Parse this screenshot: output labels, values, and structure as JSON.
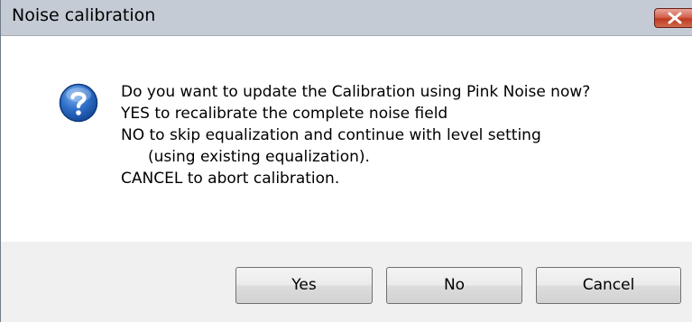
{
  "window": {
    "title": "Noise calibration"
  },
  "icons": {
    "close": "close-icon",
    "question": "question-icon"
  },
  "message": {
    "lines": [
      "Do you want to update the Calibration using Pink Noise now?",
      "YES to recalibrate the complete noise field",
      "NO to skip equalization and continue with level setting",
      "(using existing equalization).",
      "CANCEL to abort calibration."
    ]
  },
  "buttons": {
    "yes": "Yes",
    "no": "No",
    "cancel": "Cancel"
  },
  "colors": {
    "titlebar": "#c4cbd4",
    "close_button": "#c7452d",
    "question_icon": "#1f5fb4",
    "footer": "#f0f0f0"
  }
}
